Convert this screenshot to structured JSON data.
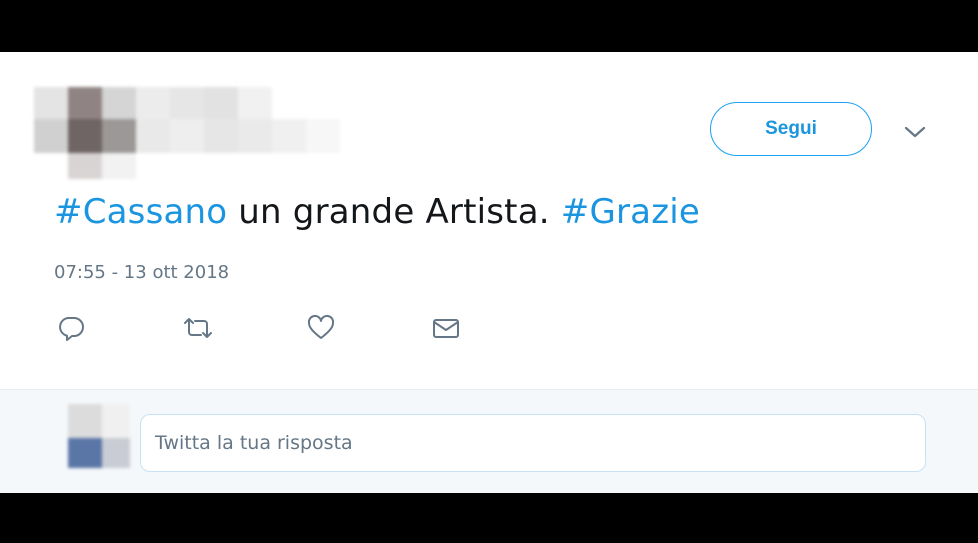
{
  "tweet": {
    "follow_label": "Segui",
    "text_hashtag1": "#Cassano",
    "text_body": " un grande Artista. ",
    "text_hashtag2": "#Grazie",
    "timestamp": "07:55 - 13 ott 2018"
  },
  "actions": [
    {
      "icon": "reply-icon"
    },
    {
      "icon": "retweet-icon"
    },
    {
      "icon": "like-icon"
    },
    {
      "icon": "direct-message-icon"
    }
  ],
  "reply": {
    "placeholder": "Twitta la tua risposta"
  },
  "colors": {
    "accent": "#1da1f2",
    "link": "#1b95e0",
    "text": "#14171a",
    "muted": "#657786",
    "reply_bg": "#f5f8fa"
  }
}
